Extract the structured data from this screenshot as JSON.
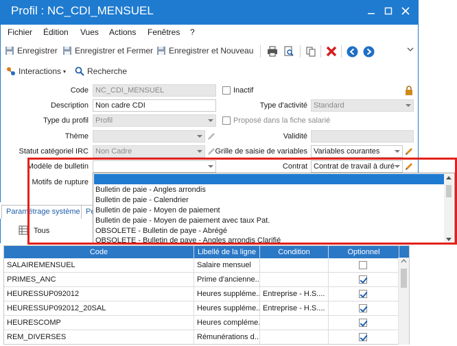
{
  "window": {
    "title": "Profil : NC_CDI_MENSUEL"
  },
  "menu": [
    "Fichier",
    "Édition",
    "Vues",
    "Actions",
    "Fenêtres",
    "?"
  ],
  "toolbar": {
    "save": "Enregistrer",
    "save_close": "Enregistrer et Fermer",
    "save_new": "Enregistrer et Nouveau"
  },
  "toolbar2": {
    "interactions": "Interactions",
    "search": "Recherche"
  },
  "form": {
    "code_label": "Code",
    "code_value": "NC_CDI_MENSUEL",
    "inactif_label": "Inactif",
    "description_label": "Description",
    "description_value": "Non cadre CDI",
    "type_activite_label": "Type d'activité",
    "type_activite_value": "Standard",
    "type_profil_label": "Type du profil",
    "type_profil_value": "Profil",
    "propose_label": "Proposé dans la fiche salarié",
    "theme_label": "Thème",
    "validite_label": "Validité",
    "statut_label": "Statut catégoriel IRC",
    "statut_value": "Non Cadre",
    "grille_label": "Grille de saisie de variables",
    "grille_value": "Variables courantes",
    "modele_label": "Modèle de bulletin",
    "contrat_label": "Contrat",
    "contrat_value": "Contrat de travail à duré",
    "motifs_label": "Motifs de rupture"
  },
  "dropdown": {
    "options": [
      "Bulletin de paie - Angles arrondis",
      "Bulletin de paie - Calendrier",
      "Bulletin de paie - Moyen de paiement",
      "Bulletin de paie - Moyen de paiement avec taux Pat.",
      "OBSOLETE - Bulletin de paye - Abrégé",
      "OBSOLETE - Bulletin de paye - Angles arrondis Clarifié"
    ]
  },
  "tabs": {
    "system": "Paramétrage système",
    "other": "Pe"
  },
  "subbar": {
    "tous": "Tous"
  },
  "grid": {
    "headers": [
      "Code",
      "Libellé de la ligne",
      "Condition",
      "Optionnel"
    ],
    "rows": [
      {
        "code": "SALAIREMENSUEL",
        "libelle": "Salaire mensuel",
        "condition": "",
        "optionnel": false
      },
      {
        "code": "PRIMES_ANC",
        "libelle": "Prime d'ancienne...",
        "condition": "",
        "optionnel": true
      },
      {
        "code": "HEURESSUP092012",
        "libelle": "Heures suppléme...",
        "condition": "Entreprise - H.S....",
        "optionnel": true
      },
      {
        "code": "HEURESSUP092012_20SAL",
        "libelle": "Heures suppléme...",
        "condition": "Entreprise - H.S....",
        "optionnel": true
      },
      {
        "code": "HEURESCOMP",
        "libelle": "Heures compléme...",
        "condition": "",
        "optionnel": true
      },
      {
        "code": "REM_DIVERSES",
        "libelle": "Rémunérations d...",
        "condition": "",
        "optionnel": true
      }
    ]
  },
  "colors": {
    "accent": "#1f7bd0",
    "highlight": "#e3201b"
  }
}
